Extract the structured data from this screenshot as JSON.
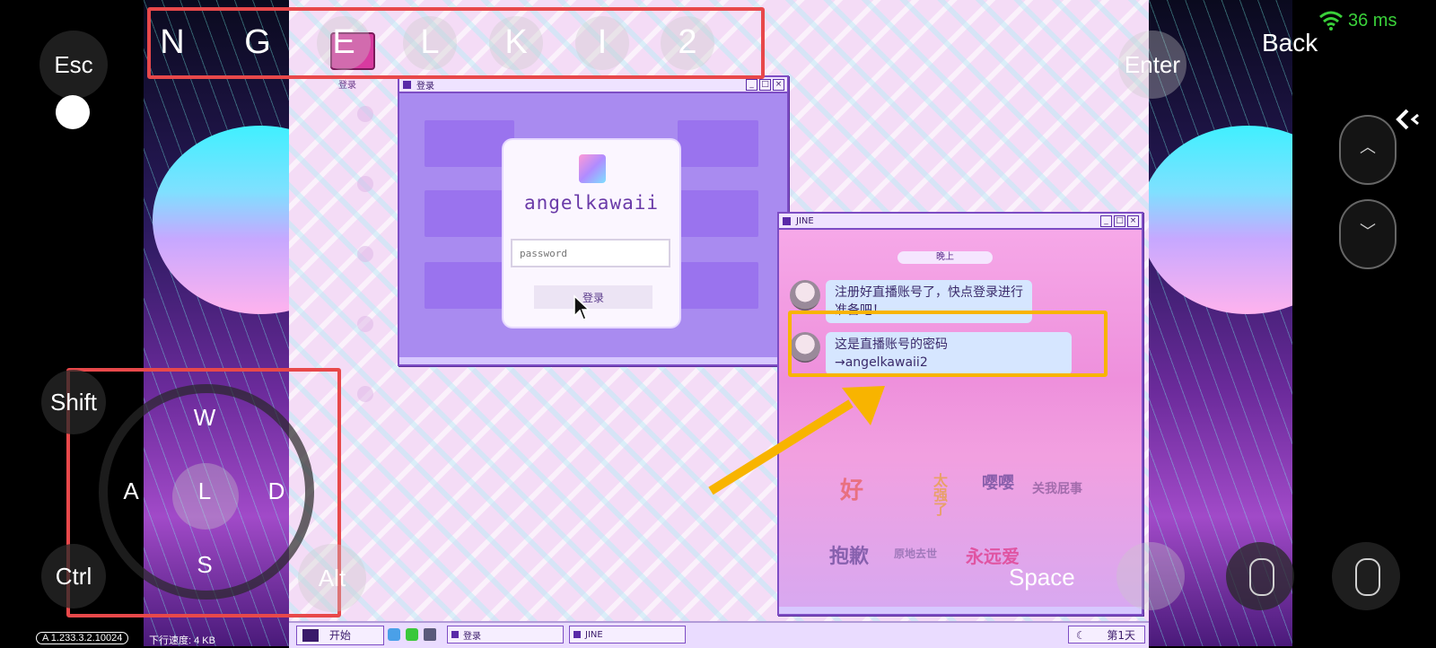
{
  "overlay": {
    "esc_label": "Esc",
    "enter_label": "Enter",
    "back_label": "Back",
    "shift_label": "Shift",
    "ctrl_label": "Ctrl",
    "alt_label": "Alt",
    "space_label": "Space",
    "ping": "36 ms",
    "hotkeys": [
      "N",
      "G",
      "E",
      "L",
      "K",
      "I",
      "2"
    ],
    "joystick": {
      "up": "W",
      "left": "A",
      "center": "L",
      "right": "D",
      "down": "S"
    },
    "version": "A 1.233.3.2.10024",
    "download_speed": "下行速度: 4 KB"
  },
  "desktop": {
    "login_icon_label": "登录"
  },
  "login_window": {
    "title": "登录",
    "username": "angelkawaii",
    "password_placeholder": "password",
    "login_button": "登录"
  },
  "jine_window": {
    "title": "JINE",
    "time_chip": "晚上",
    "messages": [
      {
        "line1": "注册好直播账号了，快点登录进行",
        "line2": "准备吧！"
      },
      {
        "line1": "这是直播账号的密码",
        "line2": "→angelkawaii2"
      }
    ],
    "stickers": [
      "好",
      "太强了",
      "嘤嘤",
      "关我屁事",
      "抱歉",
      "原地去世",
      "永远爱"
    ]
  },
  "taskbar": {
    "start_label": "开始",
    "tasks": [
      "登录",
      "JINE"
    ],
    "day_label": "第1天"
  },
  "colors": {
    "highlight_red": "#e8484a",
    "highlight_yellow": "#f8b400",
    "ping_green": "#3ad13a",
    "window_border": "#7d4dc4"
  }
}
